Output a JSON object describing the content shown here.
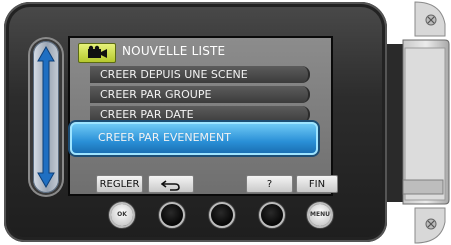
{
  "menu": {
    "title": "NOUVELLE LISTE",
    "title_icon": "movie-camera-icon",
    "items": [
      {
        "label": "CREER DEPUIS UNE SCENE",
        "selected": false
      },
      {
        "label": "CREER PAR GROUPE",
        "selected": false
      },
      {
        "label": "CREER PAR DATE",
        "selected": false
      },
      {
        "label": "CREER PAR EVENEMENT",
        "selected": true
      }
    ]
  },
  "softkeys": {
    "regler": "REGLER",
    "back_icon": "return-arrow-icon",
    "help": "?",
    "fin": "FIN"
  },
  "hardware_buttons": {
    "ok": "OK",
    "menu": "MENU"
  },
  "colors": {
    "selected_fill": "#2a90d7",
    "selected_border": "#9ee4ff",
    "title_icon_fill": "#c8d940",
    "menu_bg": "#7a7a7a"
  }
}
